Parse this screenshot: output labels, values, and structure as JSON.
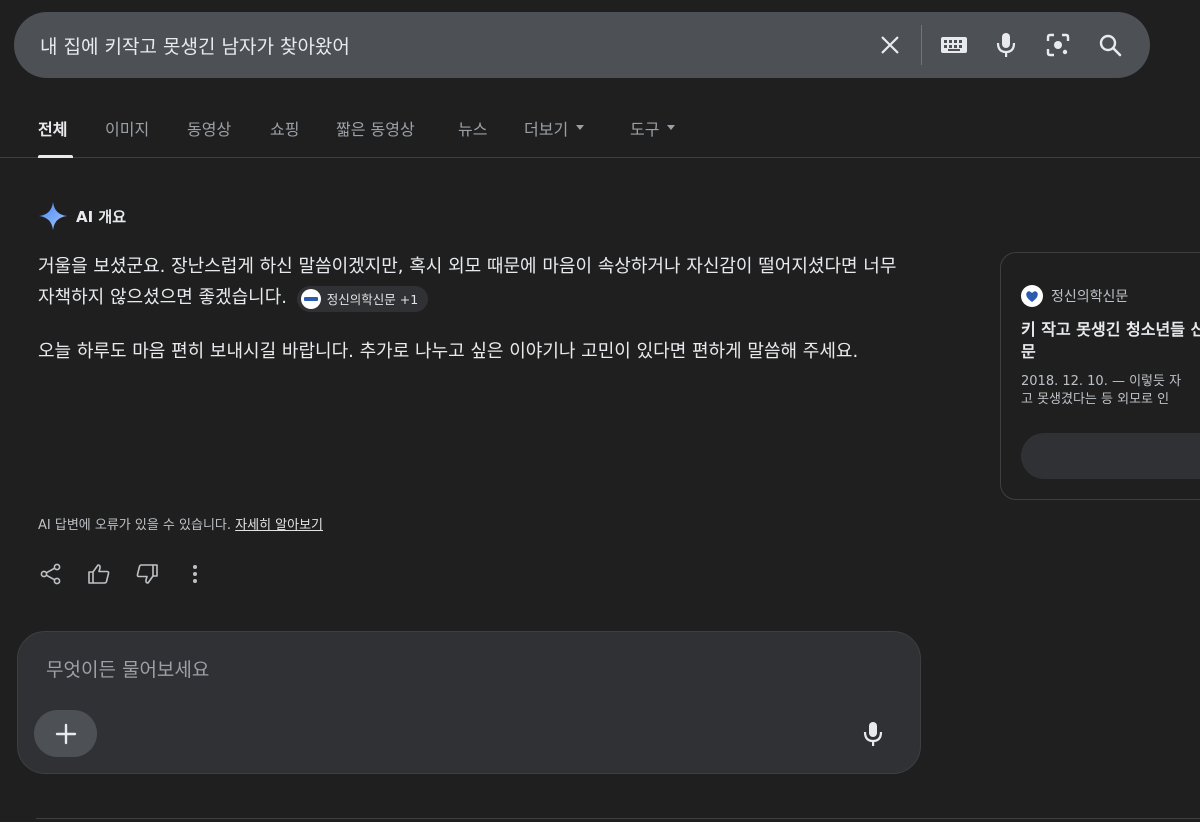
{
  "search": {
    "query": "내 집에 키작고 못생긴 남자가 찾아왔어",
    "icons": [
      "close-icon",
      "keyboard-icon",
      "microphone-icon",
      "lens-icon",
      "search-icon"
    ]
  },
  "tabs": [
    {
      "label": "전체",
      "active": true
    },
    {
      "label": "이미지"
    },
    {
      "label": "동영상"
    },
    {
      "label": "쇼핑"
    },
    {
      "label": "짧은 동영상"
    },
    {
      "label": "뉴스"
    },
    {
      "label": "더보기"
    },
    {
      "label": "도구"
    }
  ],
  "ai_overview": {
    "title": "AI 개요",
    "paragraph1": "거울을 보셨군요. 장난스럽게 하신 말씀이겠지만, 혹시 외모 때문에 마음이 속상하거나 자신감이 떨어지셨다면 너무 자책하지 않으셨으면 좋겠습니다.",
    "source_chip": "정신의학신문 +1",
    "paragraph2": "오늘 하루도 마음 편히 보내시길 바랍니다. 추가로 나누고 싶은 이야기나 고민이 있다면 편하게 말씀해 주세요.",
    "disclaimer": "AI 답변에 오류가 있을 수 있습니다.",
    "learn_more": "자세히 알아보기"
  },
  "source_card": {
    "site": "정신의학신문",
    "title": "키 작고 못생긴 청소년들 신의학신문",
    "snippet_line1": "2018. 12. 10. — 이렇듯 자",
    "snippet_line2": "고 못생겼다는 등 외모로 인"
  },
  "ask": {
    "placeholder": "무엇이든 물어보세요"
  },
  "colors": {
    "background": "#1f1f1f",
    "search_bar": "#4d5156",
    "accent_sparkle": "#8ab4f8"
  }
}
